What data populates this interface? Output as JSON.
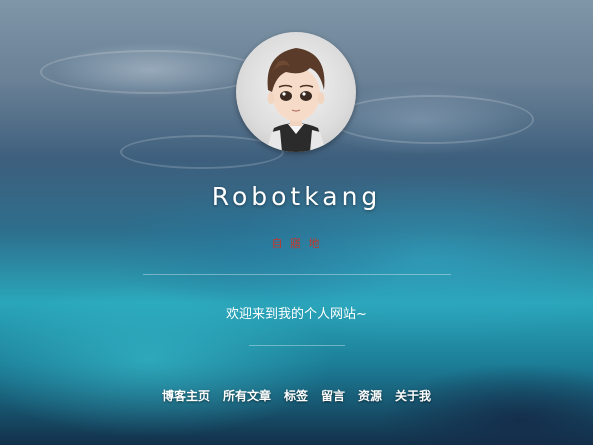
{
  "site": {
    "title": "Robotkang",
    "subtitle": "自 寤 地",
    "welcome": "欢迎来到我的个人网站~"
  },
  "nav": {
    "items": [
      {
        "label": "博客主页"
      },
      {
        "label": "所有文章"
      },
      {
        "label": "标签"
      },
      {
        "label": "留言"
      },
      {
        "label": "资源"
      },
      {
        "label": "关于我"
      }
    ]
  },
  "colors": {
    "subtitle": "#c0392b",
    "text": "#ffffff"
  }
}
